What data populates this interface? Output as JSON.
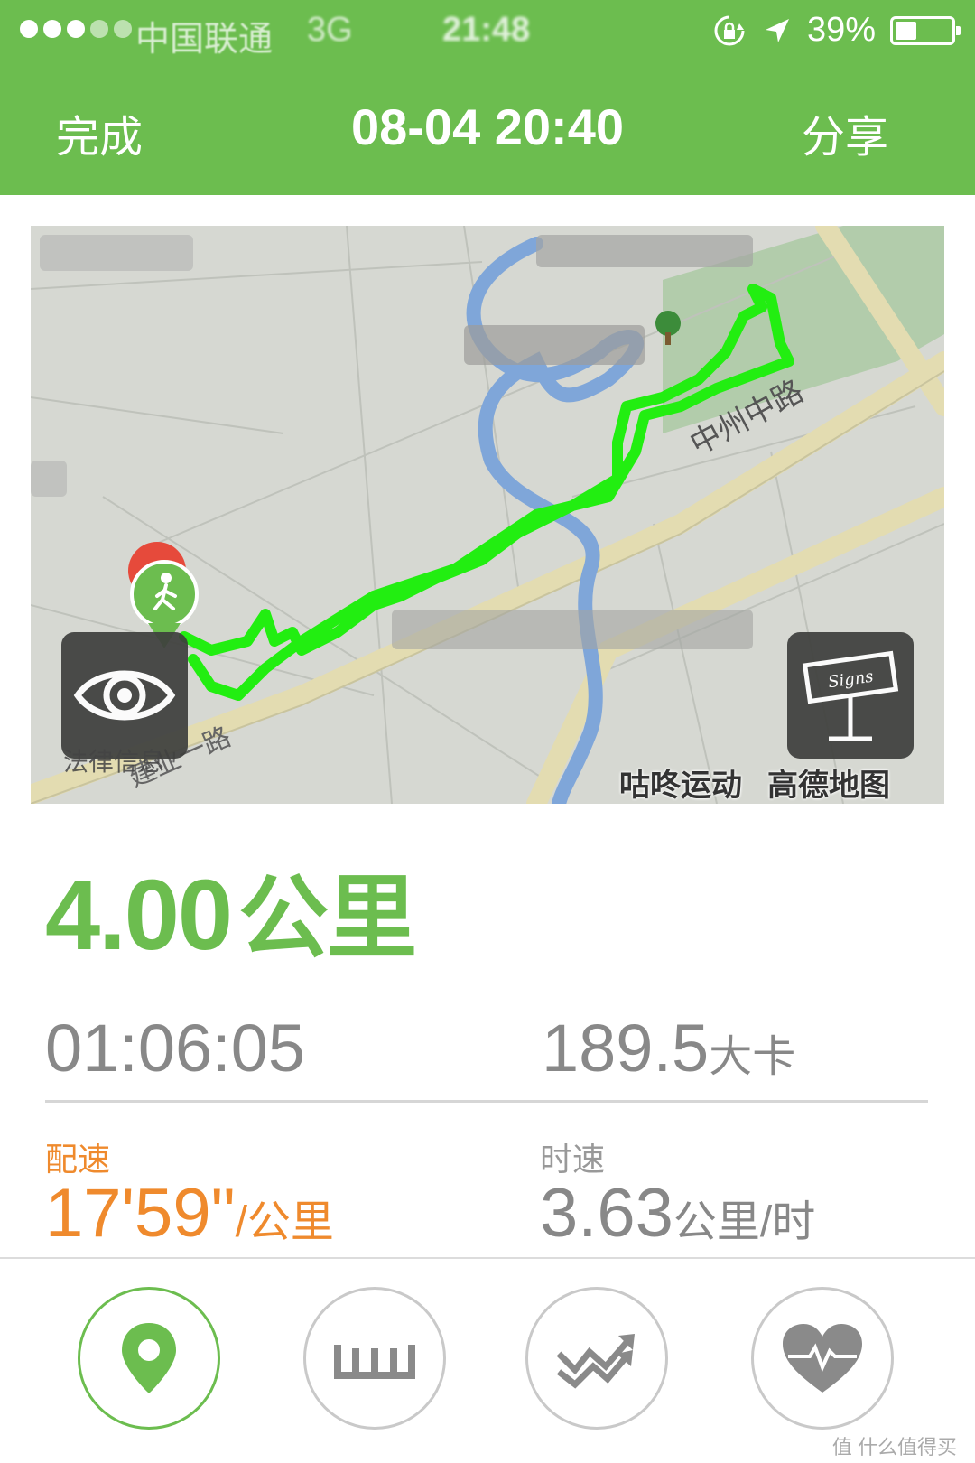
{
  "status_bar": {
    "carrier": "中国联通",
    "network": "3G",
    "time": "21:48",
    "battery_text": "39%",
    "battery_level": 0.39
  },
  "nav": {
    "done_label": "完成",
    "title": "08-04 20:40",
    "share_label": "分享"
  },
  "map": {
    "road_label_1": "中州中路",
    "road_label_2": "建业一路",
    "legal_label": "法律信息",
    "credit_app": "咕咚运动",
    "credit_map": "高德地图",
    "sign_text": "Signs"
  },
  "summary": {
    "distance_value": "4.00",
    "distance_unit": "公里",
    "duration": "01:06:05",
    "calories_value": "189.5",
    "calories_unit": "大卡",
    "pace_label": "配速",
    "pace_value": "17'59\"",
    "pace_unit": "/公里",
    "speed_label": "时速",
    "speed_value": "3.63",
    "speed_unit": "公里/时"
  },
  "tabs": [
    {
      "icon": "location-pin-icon",
      "active": true
    },
    {
      "icon": "ruler-icon",
      "active": false
    },
    {
      "icon": "trend-arrows-icon",
      "active": false
    },
    {
      "icon": "heart-rate-icon",
      "active": false
    }
  ],
  "colors": {
    "brand_green": "#6cbd4f",
    "pace_orange": "#ef8a2d",
    "track_green": "#22ee11",
    "river_blue": "#7fa6d9"
  },
  "watermark": "值 什么值得买"
}
